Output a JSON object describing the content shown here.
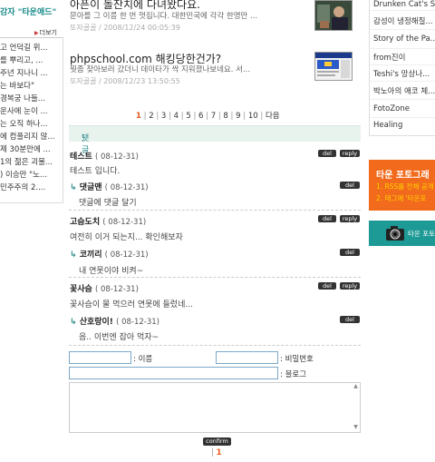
{
  "left_column": {
    "top_link": "감자 \"타운애드\"",
    "more_label": "더보기",
    "items": [
      "고 언덕길 위...",
      "를 뿌리고, ...",
      "주년 지나니 ...",
      "는 바보다\"",
      "경복궁 나들...",
      "운사에 눈이 ...",
      "는 오직 하나...",
      "에 컴플리지 않...",
      "제 30분만에 ...",
      "1의 젊은 괴물...",
      ") 이승만 \"노...",
      "민주주의 2...."
    ]
  },
  "posts": [
    {
      "title": "아픈이 돌잔치에 다녀왔다요.",
      "desc": "문아를 그 이름 한 번 멋집니다. 대한민국에 각각 한명만 ...",
      "meta": "또자골골 / 2008/12/24 00:05:39"
    },
    {
      "title": "phpschool.com 해킹당한건가?",
      "desc": "뭣좀 찾아보러 갔더니 데이타가 싹 지워졌나보네요. 서...",
      "meta": "또자골골 / 2008/12/23 13:50:55"
    }
  ],
  "pagination": {
    "pages": [
      "1",
      "2",
      "3",
      "4",
      "5",
      "6",
      "7",
      "8",
      "9",
      "10"
    ],
    "current": "1",
    "next": "다음"
  },
  "comments_header": "댓글",
  "comments": [
    {
      "name": "테스트",
      "date": "( 08-12-31)",
      "body": "테스트 입니다.",
      "del": "del",
      "reply": "reply",
      "replies": [
        {
          "name": "댓글맨",
          "date": "( 08-12-31)",
          "body": "댓글에 댓글 달기",
          "del": "del"
        }
      ]
    },
    {
      "name": "고슴도치",
      "date": "( 08-12-31)",
      "body": "여전히 이거 되는지... 확인해보자",
      "del": "del",
      "reply": "reply",
      "replies": [
        {
          "name": "코끼리",
          "date": "( 08-12-31)",
          "body": "내 연못이야 비켜~",
          "del": "del"
        }
      ]
    },
    {
      "name": "꽃사슴",
      "date": "( 08-12-31)",
      "body": "꽃사슴이 물 먹으러 연못에 들렀네...",
      "del": "del",
      "reply": "reply",
      "replies": [
        {
          "name": "산호랑이!",
          "date": "( 08-12-31)",
          "body": "음.. 이번엔 잡아 먹자~",
          "del": "del"
        }
      ]
    }
  ],
  "form": {
    "name_label": ": 이름",
    "password_label": ": 비밀번호",
    "blog_label": ": 블로그",
    "confirm_label": "confirm",
    "bottom_page": "1"
  },
  "right_column": {
    "items": [
      "Drunken Cat's S...",
      "감성이 냉정해질...",
      "Story of the Pa...",
      "from진이",
      "Teshi's 망상나...",
      "박노아의 애코 체...",
      "FotoZone",
      "Healing"
    ],
    "banner_title": "타운 포토그래",
    "banner_line1": "1. RSS를 전체 공개",
    "banner_line2": "2. 태그에 '타운포",
    "banner2_text": "타운 포토"
  },
  "colors": {
    "accent_teal": "#1a8a8a",
    "accent_orange": "#e85a1a",
    "banner_orange": "#f26a1b",
    "banner_teal": "#1d9a95",
    "comment_bar": "#e9f3ee"
  }
}
